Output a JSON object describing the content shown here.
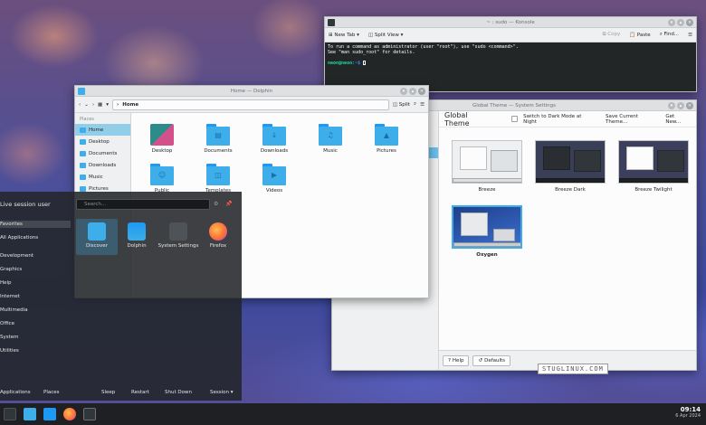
{
  "konsole": {
    "title": "~ : sudo — Konsole",
    "toolbar": {
      "new_tab": "New Tab",
      "split_view": "Split View",
      "copy": "Copy",
      "paste": "Paste",
      "find": "Find..."
    },
    "lines": [
      "To run a command as administrator (user \"root\"), use \"sudo <command>\".",
      "See \"man sudo_root\" for details."
    ],
    "prompt_user": "neon@neon",
    "prompt_path": ":~$"
  },
  "settings": {
    "title": "Global Theme — System Settings",
    "heading": "Global Theme",
    "dark_mode_label": "Switch to Dark Mode at Night",
    "save_label": "Save Current Theme...",
    "get_new_label": "Get New...",
    "themes": [
      {
        "name": "Breeze"
      },
      {
        "name": "Breeze Dark"
      },
      {
        "name": "Breeze Twilight"
      },
      {
        "name": "Oxygen",
        "selected": true
      }
    ],
    "help_label": "Help",
    "defaults_label": "Defaults"
  },
  "dolphin": {
    "title": "Home — Dolphin",
    "location": "Home",
    "split_label": "Split",
    "places_header": "Places",
    "places": [
      {
        "label": "Home",
        "active": true
      },
      {
        "label": "Desktop"
      },
      {
        "label": "Documents"
      },
      {
        "label": "Downloads"
      },
      {
        "label": "Music"
      },
      {
        "label": "Pictures"
      }
    ],
    "folders": [
      "Desktop",
      "Documents",
      "Downloads",
      "Music",
      "Pictures",
      "Public",
      "Templates",
      "Videos"
    ]
  },
  "launcher": {
    "user": "Live session user",
    "search_placeholder": "Search...",
    "categories": [
      "Favorites",
      "All Applications",
      "Development",
      "Graphics",
      "Help",
      "Internet",
      "Multimedia",
      "Office",
      "System",
      "Utilities"
    ],
    "apps": [
      {
        "name": "Discover"
      },
      {
        "name": "Dolphin"
      },
      {
        "name": "System Settings"
      },
      {
        "name": "Firefox"
      }
    ],
    "footer": {
      "applications": "Applications",
      "places": "Places",
      "sleep": "Sleep",
      "restart": "Restart",
      "shutdown": "Shut Down",
      "session": "Session"
    }
  },
  "taskbar": {
    "time": "09:14",
    "date": "6 Apr 2024"
  },
  "watermark": "STUGLINUX.COM"
}
